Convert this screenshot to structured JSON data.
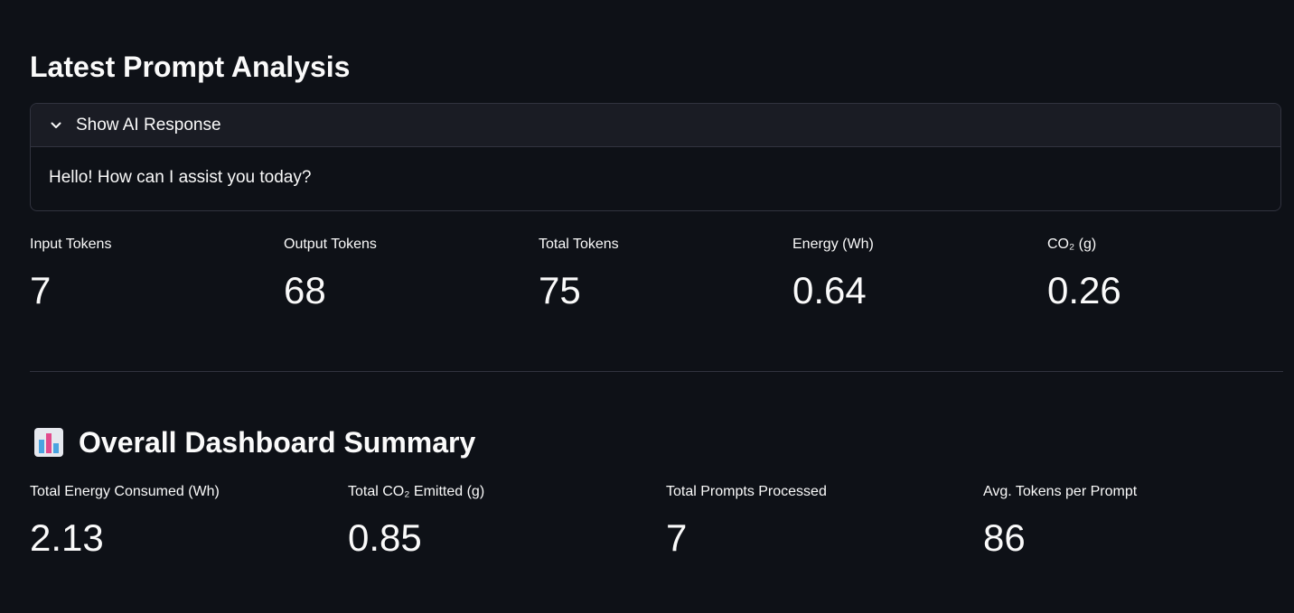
{
  "latest": {
    "title": "Latest Prompt Analysis",
    "expander": {
      "label": "Show AI Response",
      "response": "Hello! How can I assist you today?"
    },
    "metrics": [
      {
        "label": "Input Tokens",
        "value": "7"
      },
      {
        "label": "Output Tokens",
        "value": "68"
      },
      {
        "label": "Total Tokens",
        "value": "75"
      },
      {
        "label": "Energy (Wh)",
        "value": "0.64"
      },
      {
        "label": "CO₂ (g)",
        "value": "0.26"
      }
    ]
  },
  "summary": {
    "icon": "bar-chart-emoji",
    "title": "Overall Dashboard Summary",
    "metrics": [
      {
        "label": "Total Energy Consumed (Wh)",
        "value": "2.13"
      },
      {
        "label": "Total CO₂ Emitted (g)",
        "value": "0.85"
      },
      {
        "label": "Total Prompts Processed",
        "value": "7"
      },
      {
        "label": "Avg. Tokens per Prompt",
        "value": "86"
      }
    ]
  }
}
